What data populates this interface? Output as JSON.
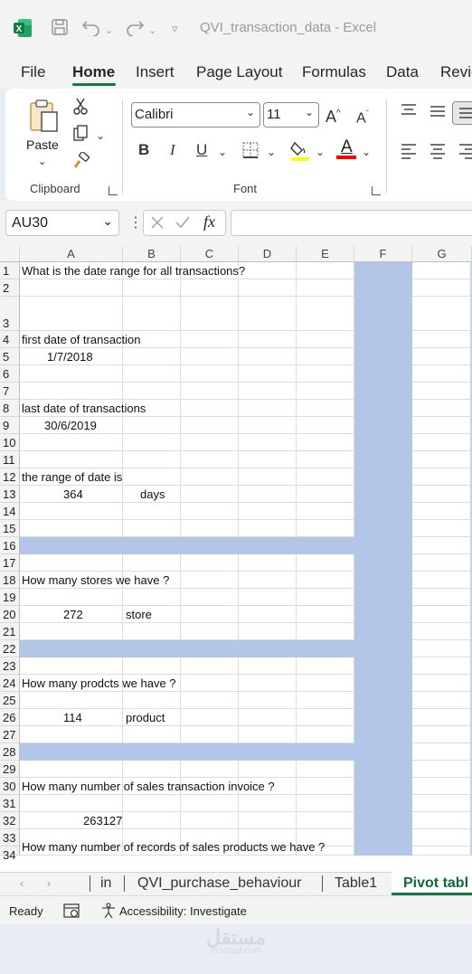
{
  "titlebar": {
    "doc_title": "QVI_transaction_data  -  Excel"
  },
  "ribbon_tabs": [
    "File",
    "Home",
    "Insert",
    "Page Layout",
    "Formulas",
    "Data",
    "Revie"
  ],
  "clipboard": {
    "paste_label": "Paste",
    "group_label": "Clipboard"
  },
  "font": {
    "name": "Calibri",
    "size": "11",
    "grow_label": "A",
    "shrink_label": "A",
    "bold_label": "B",
    "italic_label": "I",
    "underline_label": "U",
    "font_color_label": "A",
    "group_label": "Font",
    "highlight_color": "#ffff00",
    "font_color": "#ff0000"
  },
  "formula_bar": {
    "name_box": "AU30",
    "fx_label": "fx",
    "formula_value": ""
  },
  "columns": [
    "A",
    "B",
    "C",
    "D",
    "E",
    "F",
    "G"
  ],
  "rows": [
    "1",
    "2",
    "3",
    "4",
    "5",
    "6",
    "7",
    "8",
    "9",
    "10",
    "11",
    "12",
    "13",
    "14",
    "15",
    "16",
    "17",
    "18",
    "19",
    "20",
    "21",
    "22",
    "23",
    "24",
    "25",
    "26",
    "27",
    "28",
    "29",
    "30",
    "31",
    "32",
    "33",
    "34"
  ],
  "cells": {
    "a1": "What is the date range for all transactions?",
    "a4": "first date of transaction",
    "a5": "1/7/2018",
    "a8": "last date of transactions",
    "a9": "30/6/2019",
    "a12": "the range of date is",
    "a13": "364",
    "b13": "days",
    "a18": "How many stores we have ?",
    "a20": "272",
    "b20": "store",
    "a24": "How many prodcts we have ?",
    "a26": "114",
    "b26": "product",
    "a30": "How many number of sales transaction invoice ?",
    "a32": "263127",
    "a34": "How many number of records of sales products we have ?"
  },
  "highlight_color": "#b4c6e7",
  "sheet_tabs": [
    "in",
    "QVI_purchase_behaviour",
    "Table1",
    "Pivot tabl"
  ],
  "status": {
    "ready": "Ready",
    "accessibility": "Accessibility: Investigate"
  },
  "watermark": {
    "arabic": "مستقل",
    "latin": "mostaql.com"
  }
}
